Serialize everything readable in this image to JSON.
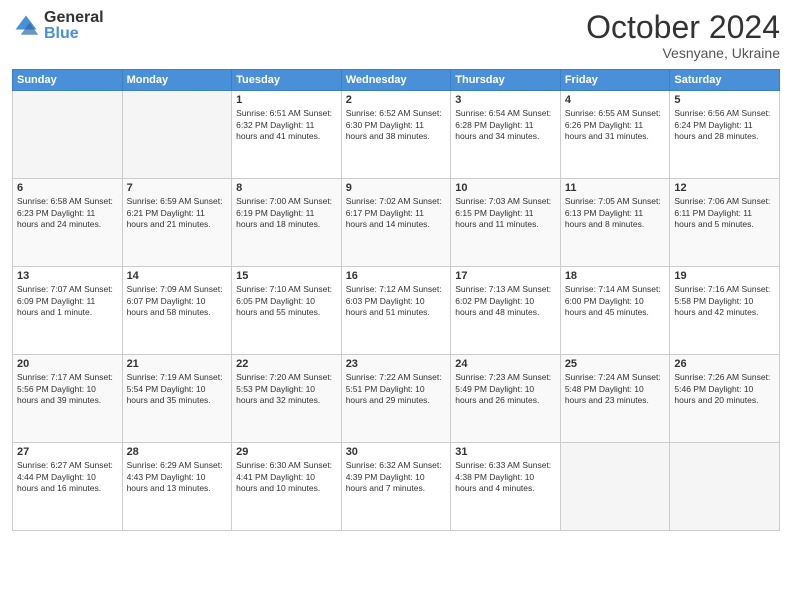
{
  "header": {
    "logo_general": "General",
    "logo_blue": "Blue",
    "month_title": "October 2024",
    "location": "Vesnyane, Ukraine"
  },
  "days_of_week": [
    "Sunday",
    "Monday",
    "Tuesday",
    "Wednesday",
    "Thursday",
    "Friday",
    "Saturday"
  ],
  "weeks": [
    [
      {
        "day": "",
        "info": ""
      },
      {
        "day": "",
        "info": ""
      },
      {
        "day": "1",
        "info": "Sunrise: 6:51 AM\nSunset: 6:32 PM\nDaylight: 11 hours and 41 minutes."
      },
      {
        "day": "2",
        "info": "Sunrise: 6:52 AM\nSunset: 6:30 PM\nDaylight: 11 hours and 38 minutes."
      },
      {
        "day": "3",
        "info": "Sunrise: 6:54 AM\nSunset: 6:28 PM\nDaylight: 11 hours and 34 minutes."
      },
      {
        "day": "4",
        "info": "Sunrise: 6:55 AM\nSunset: 6:26 PM\nDaylight: 11 hours and 31 minutes."
      },
      {
        "day": "5",
        "info": "Sunrise: 6:56 AM\nSunset: 6:24 PM\nDaylight: 11 hours and 28 minutes."
      }
    ],
    [
      {
        "day": "6",
        "info": "Sunrise: 6:58 AM\nSunset: 6:23 PM\nDaylight: 11 hours and 24 minutes."
      },
      {
        "day": "7",
        "info": "Sunrise: 6:59 AM\nSunset: 6:21 PM\nDaylight: 11 hours and 21 minutes."
      },
      {
        "day": "8",
        "info": "Sunrise: 7:00 AM\nSunset: 6:19 PM\nDaylight: 11 hours and 18 minutes."
      },
      {
        "day": "9",
        "info": "Sunrise: 7:02 AM\nSunset: 6:17 PM\nDaylight: 11 hours and 14 minutes."
      },
      {
        "day": "10",
        "info": "Sunrise: 7:03 AM\nSunset: 6:15 PM\nDaylight: 11 hours and 11 minutes."
      },
      {
        "day": "11",
        "info": "Sunrise: 7:05 AM\nSunset: 6:13 PM\nDaylight: 11 hours and 8 minutes."
      },
      {
        "day": "12",
        "info": "Sunrise: 7:06 AM\nSunset: 6:11 PM\nDaylight: 11 hours and 5 minutes."
      }
    ],
    [
      {
        "day": "13",
        "info": "Sunrise: 7:07 AM\nSunset: 6:09 PM\nDaylight: 11 hours and 1 minute."
      },
      {
        "day": "14",
        "info": "Sunrise: 7:09 AM\nSunset: 6:07 PM\nDaylight: 10 hours and 58 minutes."
      },
      {
        "day": "15",
        "info": "Sunrise: 7:10 AM\nSunset: 6:05 PM\nDaylight: 10 hours and 55 minutes."
      },
      {
        "day": "16",
        "info": "Sunrise: 7:12 AM\nSunset: 6:03 PM\nDaylight: 10 hours and 51 minutes."
      },
      {
        "day": "17",
        "info": "Sunrise: 7:13 AM\nSunset: 6:02 PM\nDaylight: 10 hours and 48 minutes."
      },
      {
        "day": "18",
        "info": "Sunrise: 7:14 AM\nSunset: 6:00 PM\nDaylight: 10 hours and 45 minutes."
      },
      {
        "day": "19",
        "info": "Sunrise: 7:16 AM\nSunset: 5:58 PM\nDaylight: 10 hours and 42 minutes."
      }
    ],
    [
      {
        "day": "20",
        "info": "Sunrise: 7:17 AM\nSunset: 5:56 PM\nDaylight: 10 hours and 39 minutes."
      },
      {
        "day": "21",
        "info": "Sunrise: 7:19 AM\nSunset: 5:54 PM\nDaylight: 10 hours and 35 minutes."
      },
      {
        "day": "22",
        "info": "Sunrise: 7:20 AM\nSunset: 5:53 PM\nDaylight: 10 hours and 32 minutes."
      },
      {
        "day": "23",
        "info": "Sunrise: 7:22 AM\nSunset: 5:51 PM\nDaylight: 10 hours and 29 minutes."
      },
      {
        "day": "24",
        "info": "Sunrise: 7:23 AM\nSunset: 5:49 PM\nDaylight: 10 hours and 26 minutes."
      },
      {
        "day": "25",
        "info": "Sunrise: 7:24 AM\nSunset: 5:48 PM\nDaylight: 10 hours and 23 minutes."
      },
      {
        "day": "26",
        "info": "Sunrise: 7:26 AM\nSunset: 5:46 PM\nDaylight: 10 hours and 20 minutes."
      }
    ],
    [
      {
        "day": "27",
        "info": "Sunrise: 6:27 AM\nSunset: 4:44 PM\nDaylight: 10 hours and 16 minutes."
      },
      {
        "day": "28",
        "info": "Sunrise: 6:29 AM\nSunset: 4:43 PM\nDaylight: 10 hours and 13 minutes."
      },
      {
        "day": "29",
        "info": "Sunrise: 6:30 AM\nSunset: 4:41 PM\nDaylight: 10 hours and 10 minutes."
      },
      {
        "day": "30",
        "info": "Sunrise: 6:32 AM\nSunset: 4:39 PM\nDaylight: 10 hours and 7 minutes."
      },
      {
        "day": "31",
        "info": "Sunrise: 6:33 AM\nSunset: 4:38 PM\nDaylight: 10 hours and 4 minutes."
      },
      {
        "day": "",
        "info": ""
      },
      {
        "day": "",
        "info": ""
      }
    ]
  ]
}
